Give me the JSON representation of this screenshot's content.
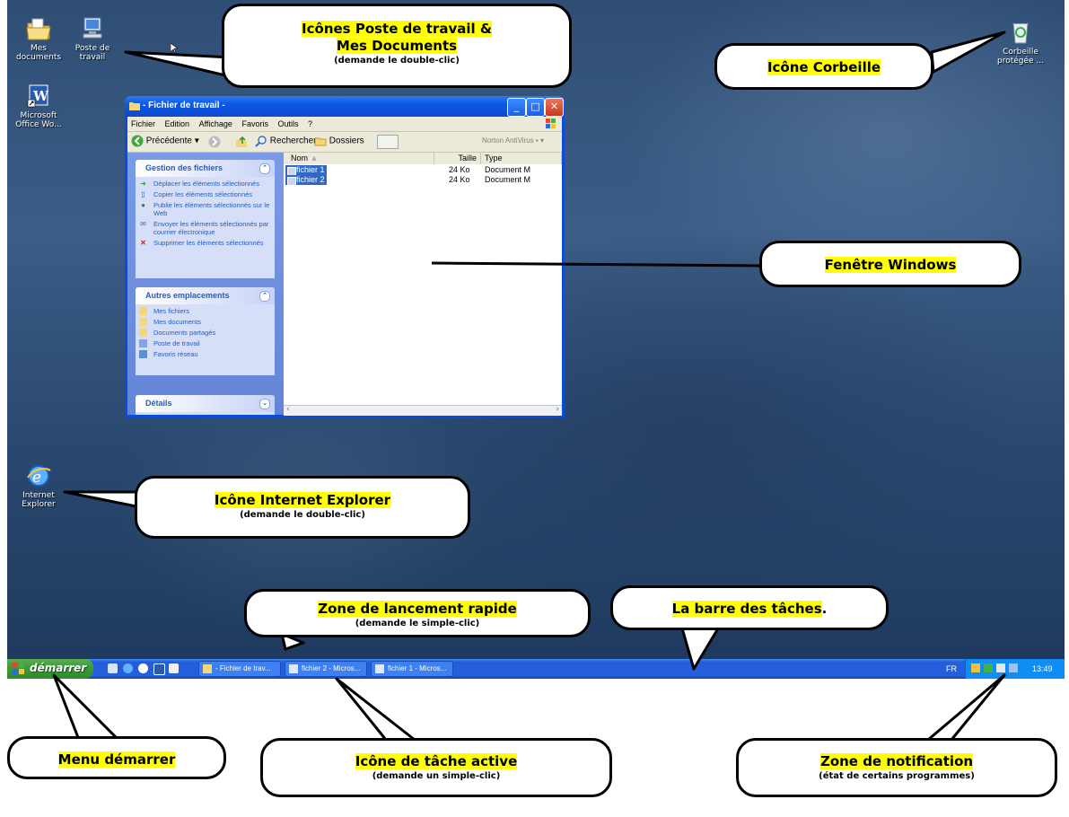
{
  "desktop_icons": {
    "my_documents": "Mes documents",
    "my_computer": "Poste de travail",
    "word_shortcut": "Microsoft Office Wo...",
    "ie": "Internet Explorer",
    "recycle_bin": "Corbeille protégée ..."
  },
  "window": {
    "title": "- Fichier de travail -",
    "menu": [
      "Fichier",
      "Edition",
      "Affichage",
      "Favoris",
      "Outils",
      "?"
    ],
    "toolbar": {
      "back": "Précédente",
      "search": "Rechercher",
      "folders": "Dossiers",
      "antivirus": "Norton AntiVirus"
    },
    "panels": {
      "file_tasks": {
        "title": "Gestion des fichiers",
        "items": [
          "Déplacer les éléments sélectionnés",
          "Copier les éléments sélectionnés",
          "Publie les éléments sélectionnés sur le Web",
          "Envoyer les éléments sélectionnés par courrier électronique",
          "Supprimer les éléments sélectionnés"
        ]
      },
      "other_places": {
        "title": "Autres emplacements",
        "items": [
          "Mes fichiers",
          "Mes documents",
          "Documents partagés",
          "Poste de travail",
          "Favoris réseau"
        ]
      },
      "details": {
        "title": "Détails"
      }
    },
    "columns": {
      "name": "Nom",
      "size": "Taille",
      "type": "Type"
    },
    "files": [
      {
        "name": "fichier 1",
        "size": "24 Ko",
        "type": "Document M"
      },
      {
        "name": "fichier 2",
        "size": "24 Ko",
        "type": "Document M"
      }
    ]
  },
  "taskbar": {
    "start": "démarrer",
    "tasks": [
      "- Fichier de trav...",
      "fichier 2 - Micros...",
      "fichier 1 - Micros..."
    ],
    "lang": "FR",
    "clock": "13:49"
  },
  "callouts": {
    "icons": {
      "title1": "Icônes Poste de travail &",
      "title2": "Mes Documents",
      "sub": "(demande le double-clic)"
    },
    "recycle": {
      "title": "Icône Corbeille"
    },
    "window": {
      "title": "Fenêtre Windows"
    },
    "ie": {
      "title": "Icône Internet Explorer",
      "sub": "(demande le double-clic)"
    },
    "quicklaunch": {
      "title": "Zone de lancement rapide",
      "sub": "(demande le simple-clic)"
    },
    "taskbar": {
      "title": "La barre des tâches",
      "dot": "."
    },
    "start": {
      "title": "Menu démarrer"
    },
    "active_task": {
      "title": "Icône de tâche active",
      "sub": "(demande un simple-clic)"
    },
    "notif": {
      "title": "Zone de notification",
      "sub": "(état de certains programmes)"
    }
  }
}
